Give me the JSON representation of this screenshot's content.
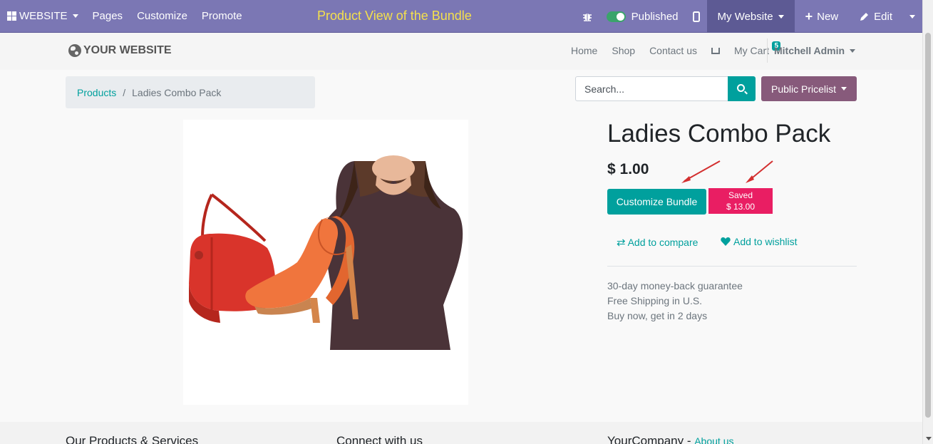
{
  "adminbar": {
    "website_label": "WEBSITE",
    "menu": [
      "Pages",
      "Customize",
      "Promote"
    ],
    "title": "Product View of the Bundle",
    "published_label": "Published",
    "my_website_label": "My Website",
    "new_label": "New",
    "edit_label": "Edit"
  },
  "header": {
    "logo_text": "YOUR WEBSITE",
    "nav": [
      "Home",
      "Shop",
      "Contact us"
    ],
    "cart_label": "My Cart",
    "cart_count": "5",
    "user_label": "Mitchell Admin"
  },
  "breadcrumb": {
    "parent": "Products",
    "separator": "/",
    "current": "Ladies Combo Pack"
  },
  "search": {
    "placeholder": "Search..."
  },
  "pricelist_label": "Public Pricelist",
  "product": {
    "title": "Ladies Combo Pack",
    "price": "$ 1.00",
    "customize_label": "Customize Bundle",
    "saved_label": "Saved",
    "saved_amount": "$ 13.00",
    "compare_label": "Add to compare",
    "wishlist_label": "Add to wishlist",
    "guarantee": [
      "30-day money-back guarantee",
      "Free Shipping in U.S.",
      "Buy now, get in 2 days"
    ]
  },
  "footer": {
    "col1_title": "Our Products & Services",
    "col2_title": "Connect with us",
    "col3_title": "YourCompany",
    "col3_link": "About us"
  },
  "colors": {
    "adminbar": "#7b77b4",
    "accent": "#00a09d",
    "pricelist": "#875a7b",
    "saved_badge": "#e91e63",
    "title_highlight": "#f4e04d"
  }
}
